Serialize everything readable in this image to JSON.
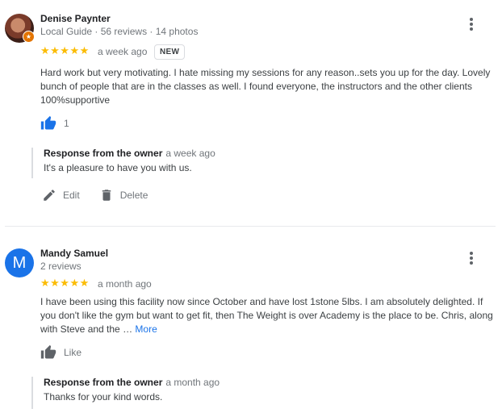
{
  "reviews": [
    {
      "name": "Denise Paynter",
      "meta": "Local Guide · 56 reviews · 14 photos",
      "stars": "★★★★★",
      "rating": 5,
      "when": "a week ago",
      "badge": "NEW",
      "text": "Hard work but very motivating. I hate missing my sessions for any reason..sets you up for the day. Lovely bunch of people that are in the classes as well. I found everyone, the instructors and the other clients 100%supportive",
      "like_label": "1",
      "response": {
        "owner_label": "Response from the owner",
        "when": "a week ago",
        "text": "It's a pleasure to have you with us."
      },
      "actions": {
        "edit": "Edit",
        "delete": "Delete"
      }
    },
    {
      "name": "Mandy Samuel",
      "avatar_letter": "M",
      "meta": "2 reviews",
      "stars": "★★★★★",
      "rating": 5,
      "when": "a month ago",
      "text": "I have been using this facility now since October and have lost 1stone 5lbs. I am absolutely delighted.  If you don't  like the gym but want to get fit, then The Weight is over Academy is the place to be. Chris, along with Steve and the … ",
      "more": "More",
      "like_label": "Like",
      "response": {
        "owner_label": "Response from the owner",
        "when": "a month ago",
        "text": "Thanks for your kind words."
      }
    }
  ],
  "colors": {
    "star": "#fbbc04",
    "like_active": "#1a73e8",
    "link": "#1a73e8",
    "avatar_m": "#1a73e8",
    "guide_badge": "#e37400"
  }
}
